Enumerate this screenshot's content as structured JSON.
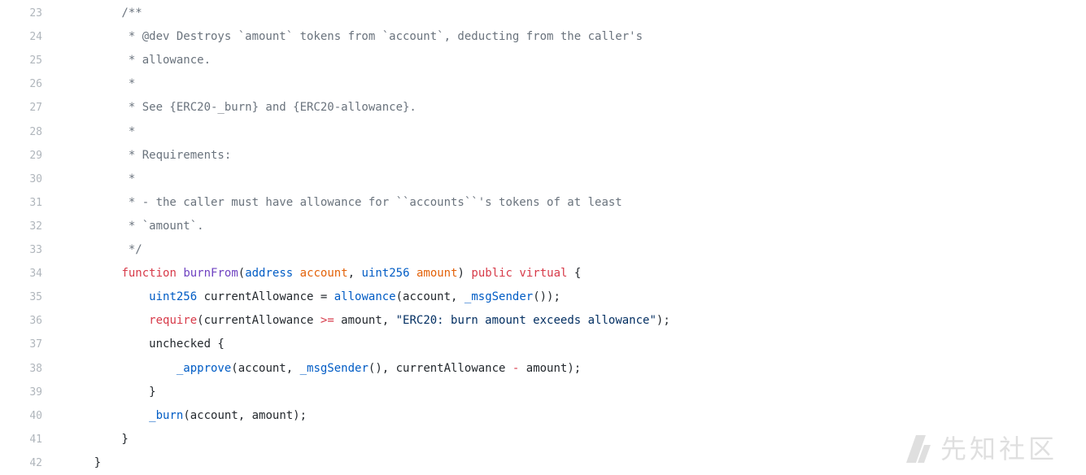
{
  "colors": {
    "line_number": "#b0b6bc",
    "plain": "#24292e",
    "comment": "#6a737d",
    "keyword": "#d73a49",
    "entity": "#6f42c1",
    "type": "#005cc5",
    "param": "#e36209",
    "string": "#032f62"
  },
  "code": {
    "lines": [
      {
        "number": "23",
        "tokens": [
          {
            "t": "comment",
            "v": "        /**"
          }
        ]
      },
      {
        "number": "24",
        "tokens": [
          {
            "t": "comment",
            "v": "         * @dev Destroys `amount` tokens from `account`, deducting from the caller's"
          }
        ]
      },
      {
        "number": "25",
        "tokens": [
          {
            "t": "comment",
            "v": "         * allowance."
          }
        ]
      },
      {
        "number": "26",
        "tokens": [
          {
            "t": "comment",
            "v": "         *"
          }
        ]
      },
      {
        "number": "27",
        "tokens": [
          {
            "t": "comment",
            "v": "         * See {ERC20-_burn} and {ERC20-allowance}."
          }
        ]
      },
      {
        "number": "28",
        "tokens": [
          {
            "t": "comment",
            "v": "         *"
          }
        ]
      },
      {
        "number": "29",
        "tokens": [
          {
            "t": "comment",
            "v": "         * Requirements:"
          }
        ]
      },
      {
        "number": "30",
        "tokens": [
          {
            "t": "comment",
            "v": "         *"
          }
        ]
      },
      {
        "number": "31",
        "tokens": [
          {
            "t": "comment",
            "v": "         * - the caller must have allowance for ``accounts``'s tokens of at least"
          }
        ]
      },
      {
        "number": "32",
        "tokens": [
          {
            "t": "comment",
            "v": "         * `amount`."
          }
        ]
      },
      {
        "number": "33",
        "tokens": [
          {
            "t": "comment",
            "v": "         */"
          }
        ]
      },
      {
        "number": "34",
        "tokens": [
          {
            "t": "plain",
            "v": "        "
          },
          {
            "t": "keyword",
            "v": "function"
          },
          {
            "t": "plain",
            "v": " "
          },
          {
            "t": "entity",
            "v": "burnFrom"
          },
          {
            "t": "plain",
            "v": "("
          },
          {
            "t": "type",
            "v": "address"
          },
          {
            "t": "plain",
            "v": " "
          },
          {
            "t": "param",
            "v": "account"
          },
          {
            "t": "plain",
            "v": ", "
          },
          {
            "t": "type",
            "v": "uint256"
          },
          {
            "t": "plain",
            "v": " "
          },
          {
            "t": "param",
            "v": "amount"
          },
          {
            "t": "plain",
            "v": ") "
          },
          {
            "t": "keyword",
            "v": "public"
          },
          {
            "t": "plain",
            "v": " "
          },
          {
            "t": "keyword",
            "v": "virtual"
          },
          {
            "t": "plain",
            "v": " {"
          }
        ]
      },
      {
        "number": "35",
        "tokens": [
          {
            "t": "plain",
            "v": "            "
          },
          {
            "t": "type",
            "v": "uint256"
          },
          {
            "t": "plain",
            "v": " currentAllowance = "
          },
          {
            "t": "type",
            "v": "allowance"
          },
          {
            "t": "plain",
            "v": "(account, "
          },
          {
            "t": "type",
            "v": "_msgSender"
          },
          {
            "t": "plain",
            "v": "());"
          }
        ]
      },
      {
        "number": "36",
        "tokens": [
          {
            "t": "plain",
            "v": "            "
          },
          {
            "t": "keyword",
            "v": "require"
          },
          {
            "t": "plain",
            "v": "(currentAllowance "
          },
          {
            "t": "keyword",
            "v": ">="
          },
          {
            "t": "plain",
            "v": " amount, "
          },
          {
            "t": "string",
            "v": "\"ERC20: burn amount exceeds allowance\""
          },
          {
            "t": "plain",
            "v": ");"
          }
        ]
      },
      {
        "number": "37",
        "tokens": [
          {
            "t": "plain",
            "v": "            unchecked {"
          }
        ]
      },
      {
        "number": "38",
        "tokens": [
          {
            "t": "plain",
            "v": "                "
          },
          {
            "t": "type",
            "v": "_approve"
          },
          {
            "t": "plain",
            "v": "(account, "
          },
          {
            "t": "type",
            "v": "_msgSender"
          },
          {
            "t": "plain",
            "v": "(), currentAllowance "
          },
          {
            "t": "keyword",
            "v": "-"
          },
          {
            "t": "plain",
            "v": " amount);"
          }
        ]
      },
      {
        "number": "39",
        "tokens": [
          {
            "t": "plain",
            "v": "            }"
          }
        ]
      },
      {
        "number": "40",
        "tokens": [
          {
            "t": "plain",
            "v": "            "
          },
          {
            "t": "type",
            "v": "_burn"
          },
          {
            "t": "plain",
            "v": "(account, amount);"
          }
        ]
      },
      {
        "number": "41",
        "tokens": [
          {
            "t": "plain",
            "v": "        }"
          }
        ]
      },
      {
        "number": "42",
        "tokens": [
          {
            "t": "plain",
            "v": "    }"
          }
        ]
      }
    ]
  },
  "watermark": {
    "icon": "xianzhi-logo-icon",
    "text": "先知社区"
  }
}
